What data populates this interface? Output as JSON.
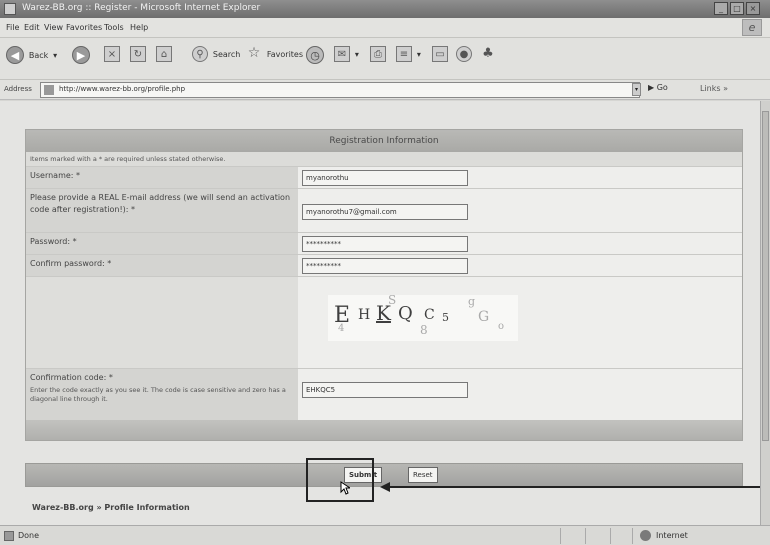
{
  "window": {
    "title": "Warez-BB.org :: Register - Microsoft Internet Explorer",
    "buttons": [
      "_",
      "□",
      "×"
    ]
  },
  "menu": [
    "File",
    "Edit",
    "View",
    "Favorites",
    "Tools",
    "Help"
  ],
  "toolbar": {
    "back_label": "Back",
    "search_label": "Search",
    "favorites_label": "Favorites",
    "icons": [
      "back-icon",
      "forward-icon",
      "stop-icon",
      "refresh-icon",
      "home-icon",
      "search-icon",
      "favorites-icon",
      "history-icon",
      "mail-icon",
      "print-icon",
      "edit-icon",
      "discuss-icon",
      "messenger-icon"
    ]
  },
  "address": {
    "label": "Address",
    "url": "http://www.warez-bb.org/profile.php",
    "go_label": "Go",
    "links_label": "Links"
  },
  "form": {
    "header": "Registration Information",
    "note": "Items marked with a * are required unless stated otherwise.",
    "username_label": "Username: *",
    "username_value": "myanorothu",
    "email_label": "Please provide a REAL E-mail address (we will send an activation code after registration!): *",
    "email_value": "myanorothu7@gmail.com",
    "password_label": "Password: *",
    "password_value": "**********",
    "confirm_label": "Confirm password: *",
    "confirm_value": "**********",
    "captcha_chars": [
      "E",
      "H",
      "K",
      "Q",
      "C",
      "5"
    ],
    "confirm_code_label": "Confirmation code: *",
    "confirm_code_help": "Enter the code exactly as you see it. The code is case sensitive and zero has a diagonal line through it.",
    "confirm_code_value": "EHKQC5"
  },
  "buttons": {
    "submit": "Submit",
    "reset": "Reset"
  },
  "breadcrumb": "Warez-BB.org » Profile Information",
  "status": {
    "text": "Done",
    "zone": "Internet"
  }
}
